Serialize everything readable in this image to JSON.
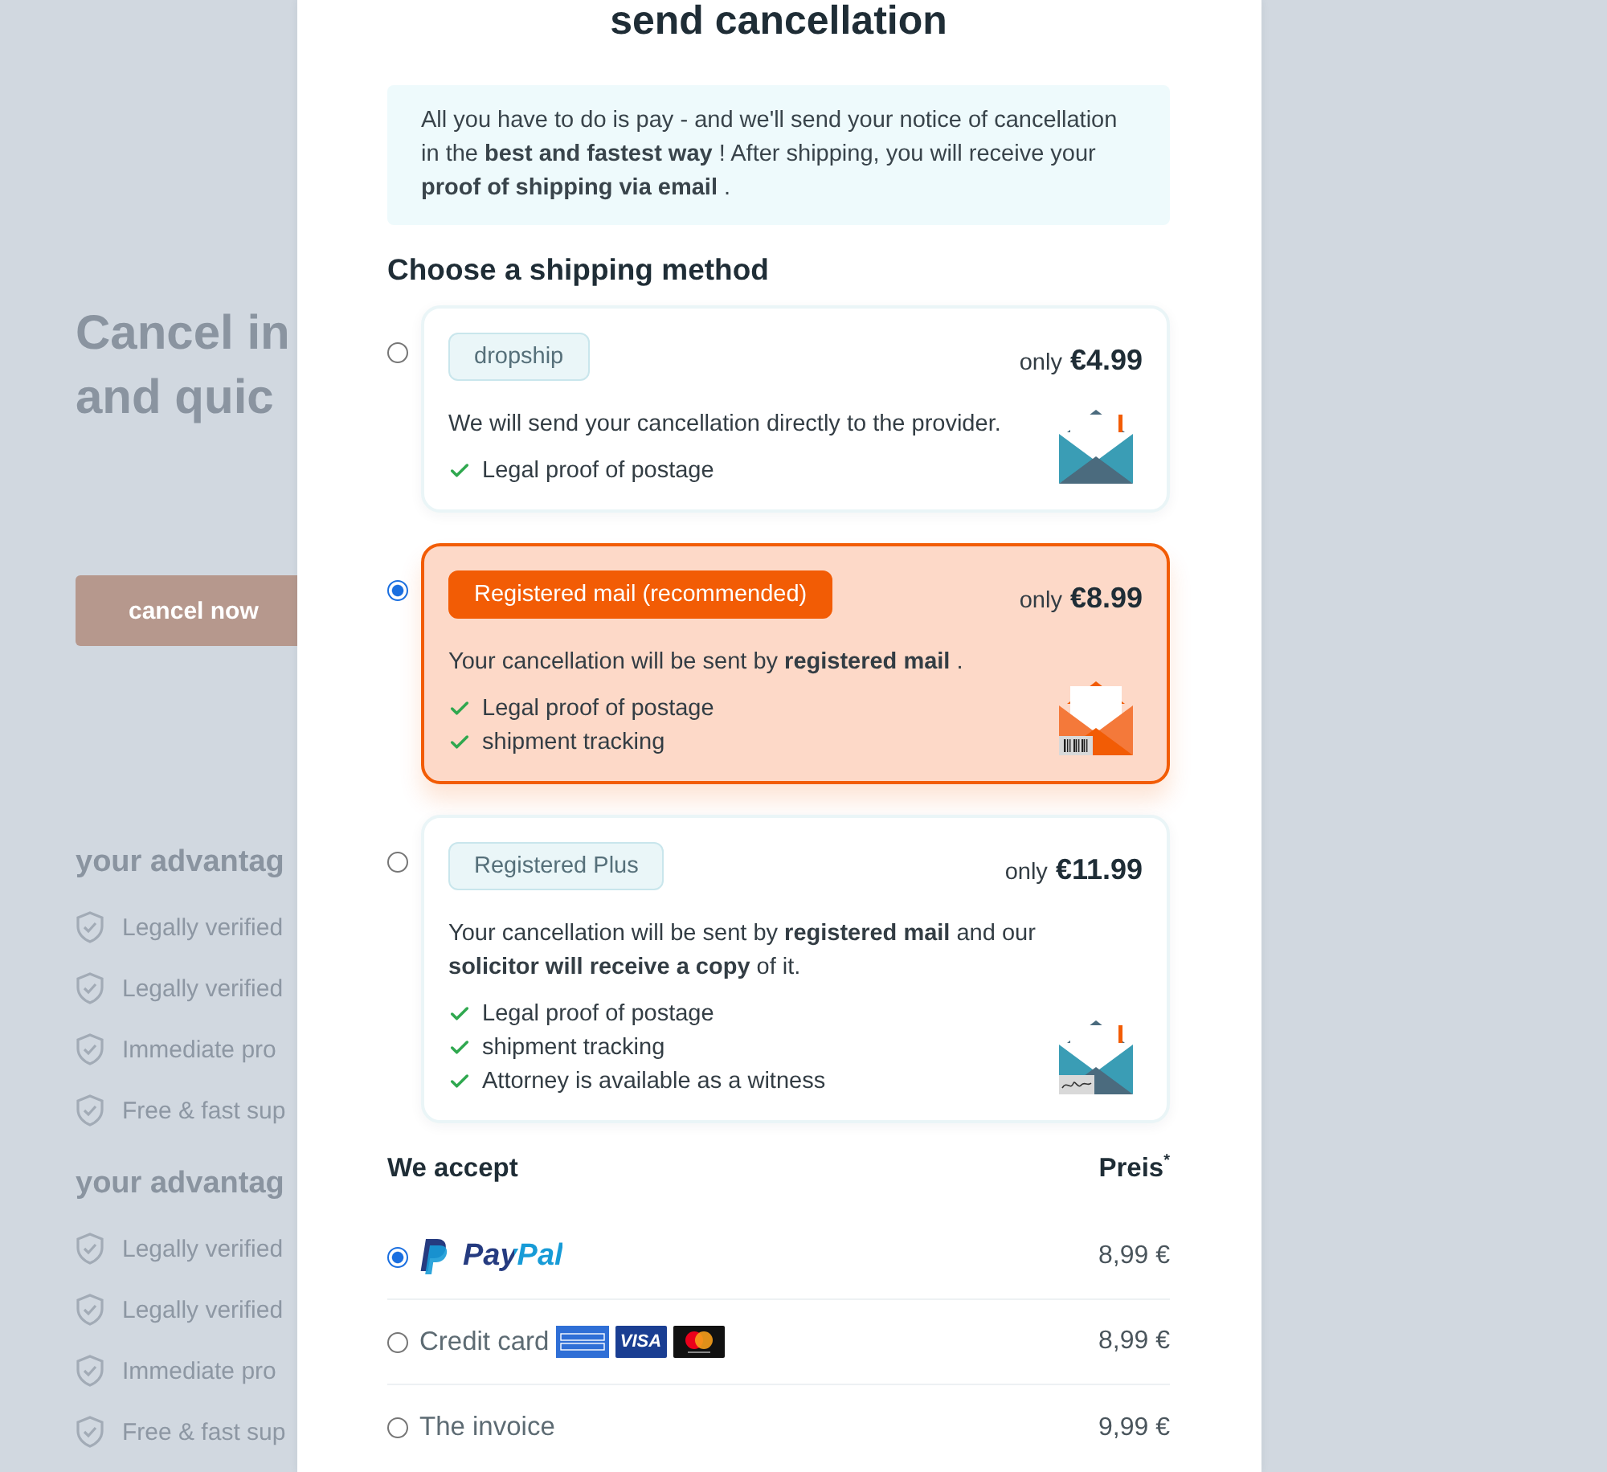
{
  "background": {
    "heading_lines": [
      "Cancel in",
      "and quic"
    ],
    "cta_button": "cancel now",
    "advantage_sections": [
      {
        "title": "your advantag",
        "items": [
          "Legally verified",
          "Legally verified",
          "Immediate pro",
          "Free & fast sup"
        ]
      },
      {
        "title": "your advantag",
        "items": [
          "Legally verified",
          "Legally verified",
          "Immediate pro",
          "Free & fast sup"
        ]
      }
    ]
  },
  "dialog": {
    "title": "send cancellation",
    "info": "All you have to do is pay - and we'll send your notice of cancellation in the **best and fastest way** ! After shipping, you will receive your **proof of shipping via email** .",
    "shipping_heading": "Choose a shipping method",
    "shipping_options": [
      {
        "kind": "envelope",
        "tag": "dropship",
        "price_prefix": "only",
        "price": "€4.99",
        "description": "We will send your cancellation directly to the provider.",
        "features": [
          "Legal proof of postage"
        ],
        "selected": false
      },
      {
        "kind": "barcode",
        "tag": "Registered mail (recommended)",
        "price_prefix": "only",
        "price": "€8.99",
        "description": "Your cancellation will be sent by **registered mail** .",
        "features": [
          "Legal proof of postage",
          "shipment tracking"
        ],
        "selected": true
      },
      {
        "kind": "signature",
        "tag": "Registered Plus",
        "price_prefix": "only",
        "price": "€11.99",
        "description": "Your cancellation will be sent by **registered mail** and our **solicitor will receive a copy** of it.",
        "features": [
          "Legal proof of postage",
          "shipment tracking",
          "Attorney is available as a witness"
        ],
        "selected": false
      }
    ],
    "payment": {
      "heading": "We accept",
      "price_heading": "Preis$^{*}$",
      "methods": [
        {
          "kind": "paypal",
          "label": "PayPal",
          "price": "8,99 €",
          "selected": true
        },
        {
          "kind": "card",
          "label": "Credit card",
          "logos": [
            {
              "kind": "amex"
            },
            {
              "kind": "visa",
              "label": "VISA"
            },
            {
              "kind": "mastercard"
            }
          ],
          "price": "8,99 €",
          "selected": false
        },
        {
          "kind": "plain",
          "label": "The invoice",
          "price": "9,99 €",
          "selected": false
        }
      ]
    }
  }
}
